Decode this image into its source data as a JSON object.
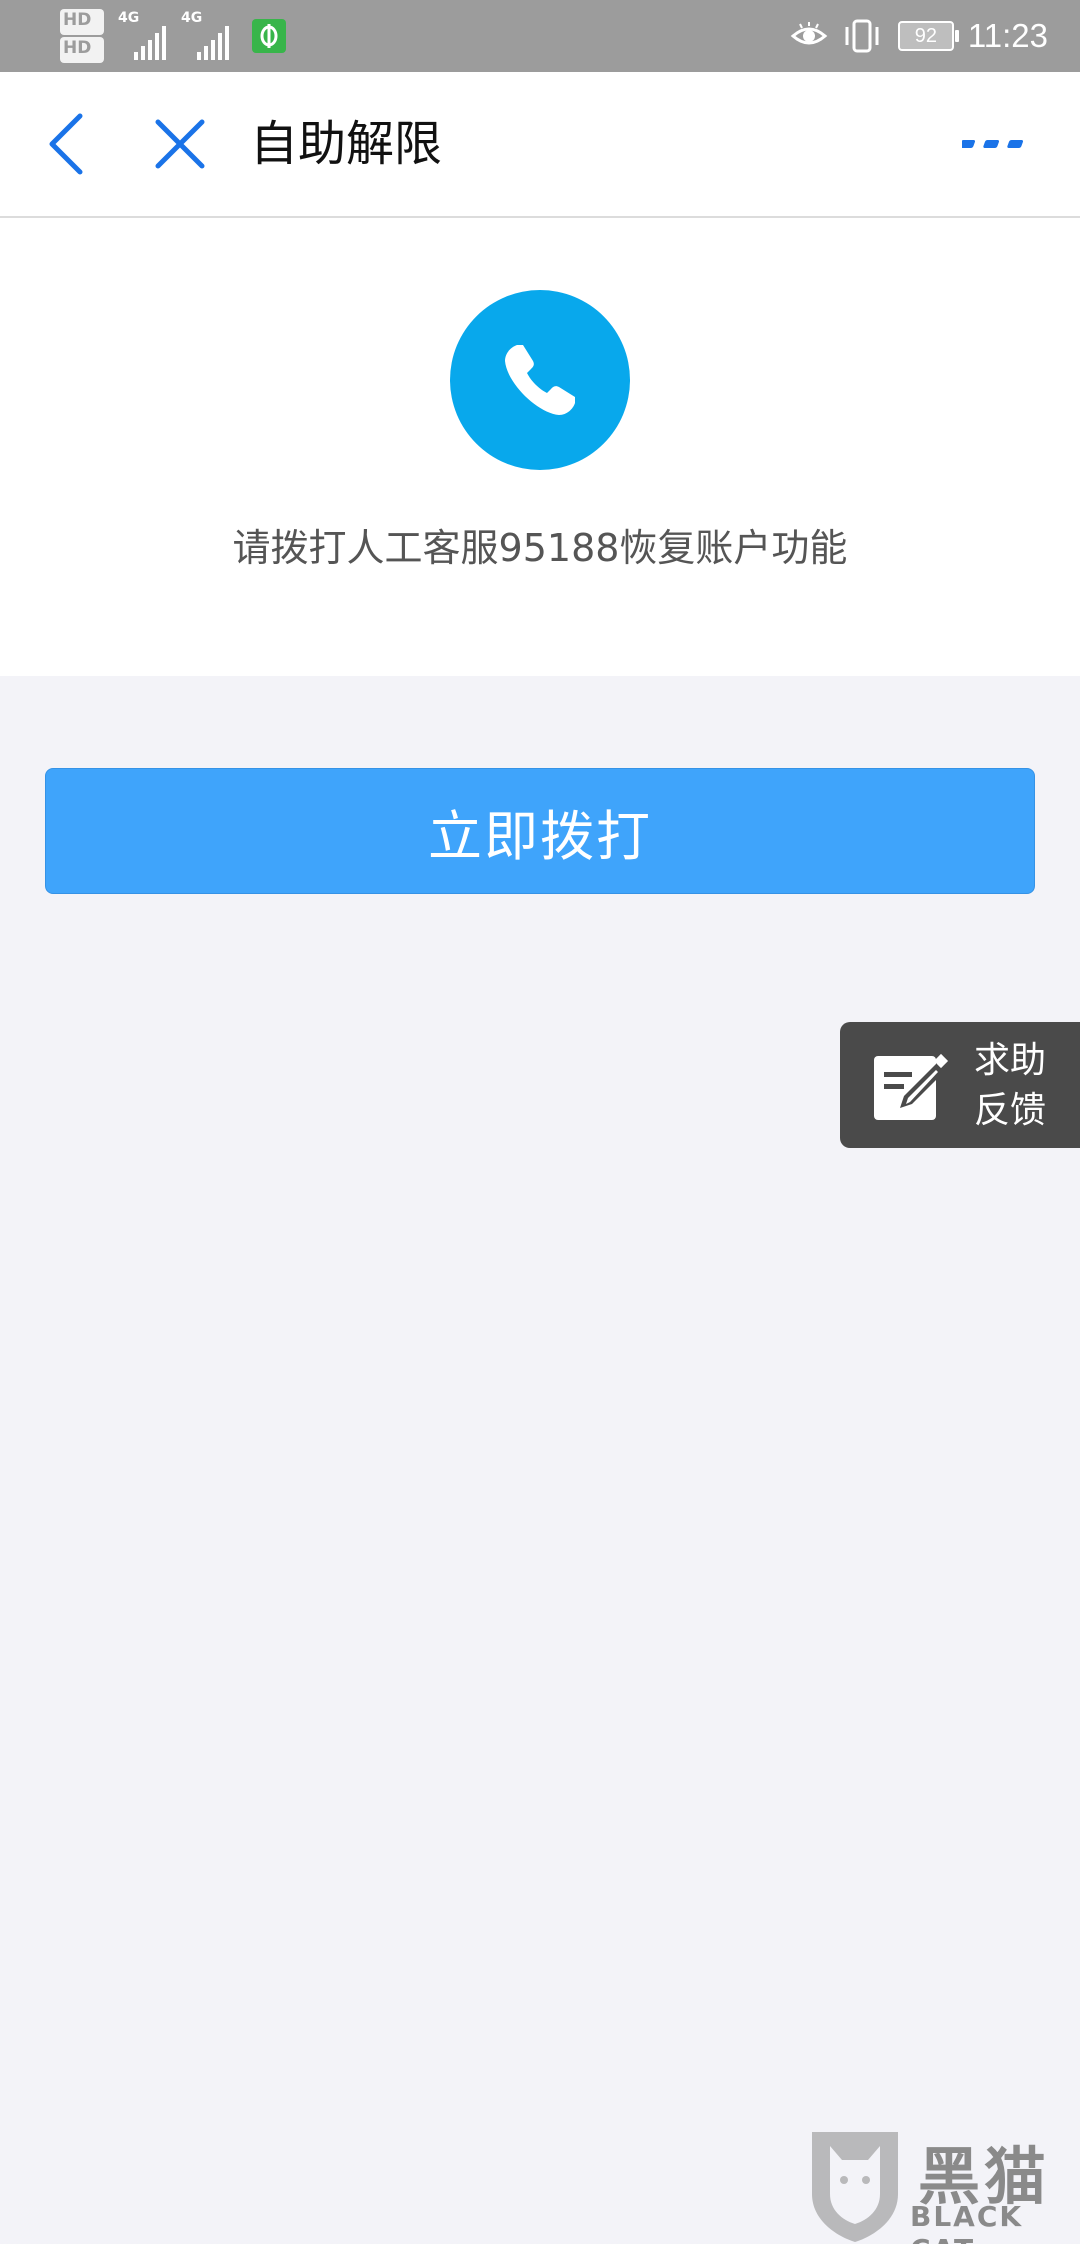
{
  "status_bar": {
    "sim1_badge": "HD",
    "sim1_index": "1",
    "sim2_badge": "HD",
    "sim2_index": "2",
    "network1": "4G",
    "network2": "4G",
    "battery_level": "92",
    "time": "11:23",
    "icons": [
      "eye-comfort-icon",
      "vibrate-icon",
      "wechat-notification-icon"
    ]
  },
  "nav": {
    "title": "自助解限",
    "back_icon": "chevron-left-icon",
    "close_icon": "close-icon",
    "more_icon": "more-dots-icon",
    "accent_color": "#1a73e8"
  },
  "info": {
    "icon": "phone-icon",
    "icon_color": "#08a8ec",
    "message": "请拨打人工客服95188恢复账户功能"
  },
  "action": {
    "call_button_label": "立即拨打",
    "button_color": "#3fa4fb"
  },
  "feedback": {
    "line1": "求助",
    "line2": "反馈",
    "icon": "edit-note-icon"
  },
  "watermark": {
    "text_cn": "黑猫",
    "text_en": "BLACK CAT"
  }
}
